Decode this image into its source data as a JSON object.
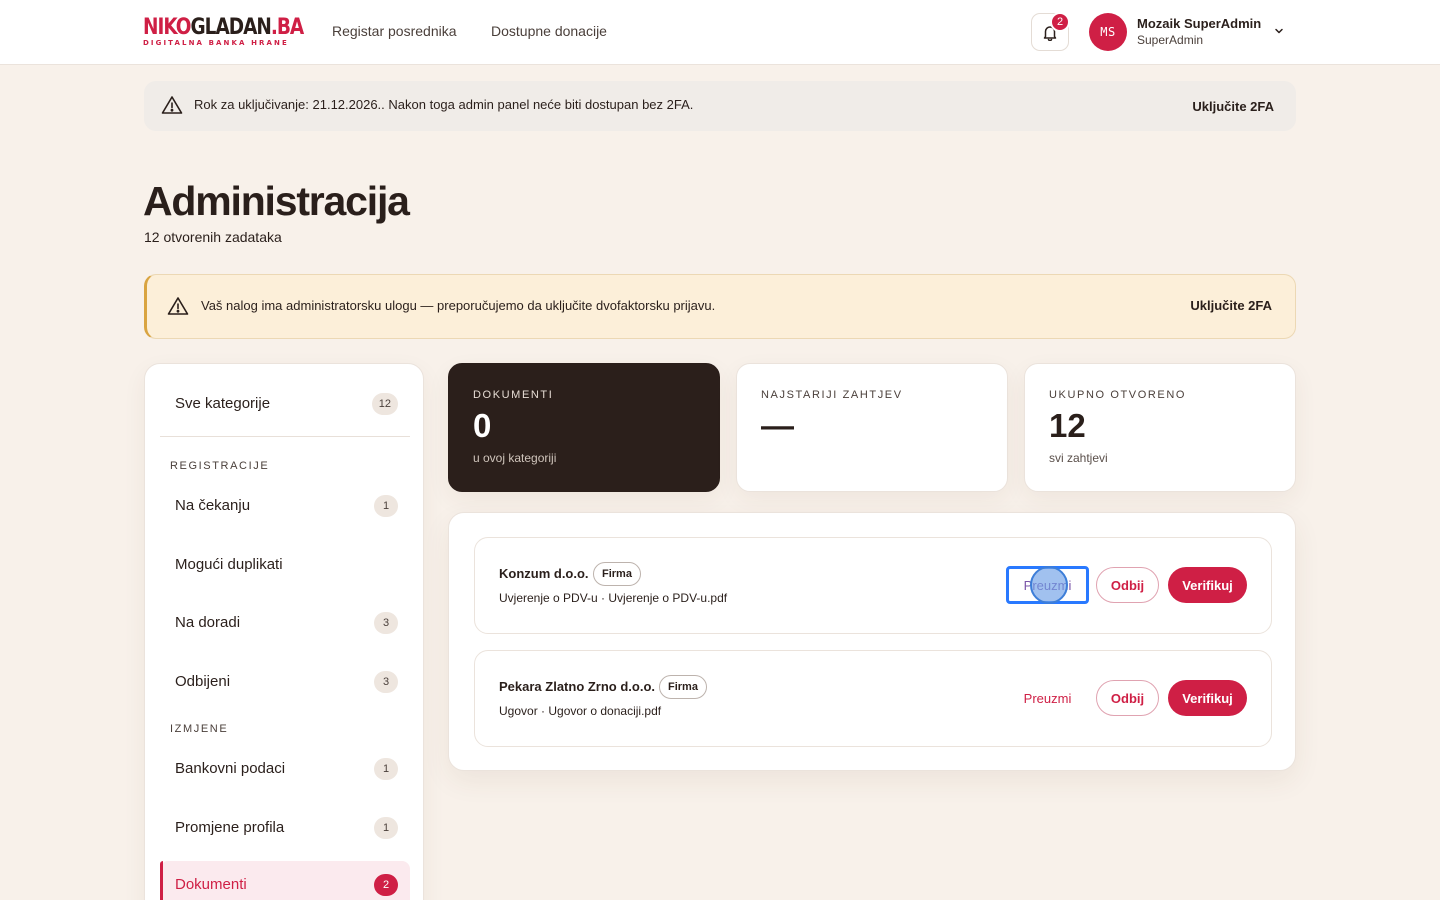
{
  "header": {
    "logo_red": "NIKO",
    "logo_dark": "GLADAN",
    "logo_tail": ".BA",
    "logo_tagline": "DIGITALNA BANKA HRANE",
    "nav": [
      "Registar posrednika",
      "Dostupne donacije"
    ],
    "notifications_count": "2",
    "user_initials": "MS",
    "user_name": "Mozaik SuperAdmin",
    "user_role": "SuperAdmin"
  },
  "notice_deadline": {
    "text": "Rok za uključivanje: 21.12.2026.. Nakon toga admin panel neće biti dostupan bez 2FA.",
    "action": "Uključite 2FA"
  },
  "page": {
    "title": "Administracija",
    "subtitle": "12 otvorenih zadataka"
  },
  "notice_admin": {
    "text": "Vaš nalog ima administratorsku ulogu — preporučujemo da uključite dvofaktorsku prijavu.",
    "action": "Uključite 2FA"
  },
  "sidebar": {
    "all": {
      "label": "Sve kategorije",
      "count": "12"
    },
    "section_registrations": "REGISTRACIJE",
    "section_changes": "IZMJENE",
    "items": [
      {
        "label": "Na čekanju",
        "count": "1"
      },
      {
        "label": "Mogući duplikati",
        "count": ""
      },
      {
        "label": "Na doradi",
        "count": "3"
      },
      {
        "label": "Odbijeni",
        "count": "3"
      },
      {
        "label": "Bankovni podaci",
        "count": "1"
      },
      {
        "label": "Promjene profila",
        "count": "1"
      },
      {
        "label": "Dokumenti",
        "count": "2",
        "active": true
      }
    ]
  },
  "stats": [
    {
      "label": "DOKUMENTI",
      "value": "0",
      "sub": "u ovoj kategoriji"
    },
    {
      "label": "NAJSTARIJI ZAHTJEV",
      "value": "—",
      "sub": ""
    },
    {
      "label": "UKUPNO OTVORENO",
      "value": "12",
      "sub": "svi zahtjevi"
    }
  ],
  "requests": [
    {
      "org": "Konzum d.o.o.",
      "tag": "Firma",
      "doc": "Uvjerenje o PDV-u · Uvjerenje o PDV-u.pdf",
      "take": "Preuzmi",
      "reject": "Odbij",
      "verify": "Verifikuj"
    },
    {
      "org": "Pekara Zlatno Zrno d.o.o.",
      "tag": "Firma",
      "doc": "Ugovor · Ugovor o donaciji.pdf",
      "take": "Preuzmi",
      "reject": "Odbij",
      "verify": "Verifikuj"
    }
  ],
  "colors": {
    "brand": "#cf1f45",
    "dark": "#2b1f1b",
    "background": "#f8f1ea"
  }
}
